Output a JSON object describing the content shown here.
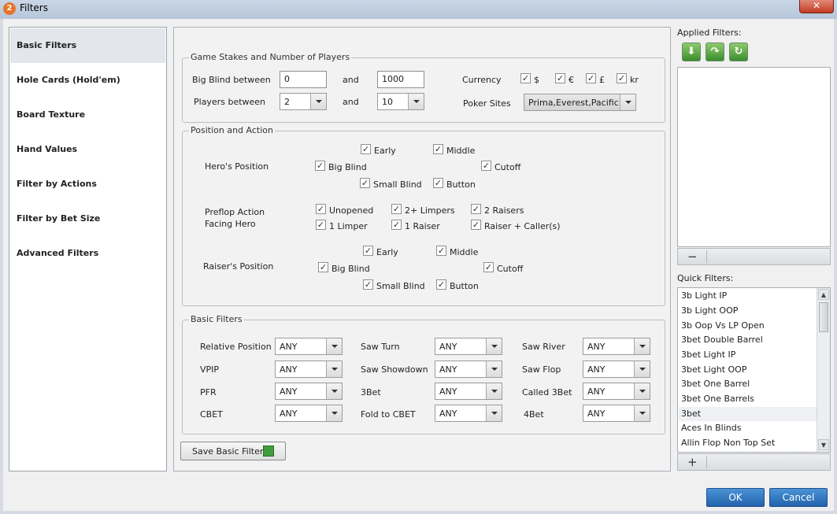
{
  "window": {
    "title": "Filters",
    "app_icon": "2",
    "close_glyph": "✕"
  },
  "nav": {
    "items": [
      "Basic Filters",
      "Hole Cards (Hold'em)",
      "Board Texture",
      "Hand Values",
      "Filter by Actions",
      "Filter by Bet Size",
      "Advanced Filters"
    ],
    "active_index": 0
  },
  "stakes": {
    "title": "Game Stakes and Number of Players",
    "big_blind_label": "Big Blind between",
    "big_blind_min": "0",
    "and1": "and",
    "big_blind_max": "1000",
    "players_label": "Players between",
    "players_min": "2",
    "and2": "and",
    "players_max": "10",
    "currency_label": "Currency",
    "currencies": [
      "$",
      "€",
      "£",
      "kr"
    ],
    "sites_label": "Poker Sites",
    "sites_value": "Prima,Everest,Pacific"
  },
  "position": {
    "title": "Position and Action",
    "hero_label": "Hero's Position",
    "hero": {
      "early": "Early",
      "middle": "Middle",
      "big_blind": "Big Blind",
      "cutoff": "Cutoff",
      "small_blind": "Small Blind",
      "button": "Button"
    },
    "preflop_label_1": "Preflop Action",
    "preflop_label_2": "Facing Hero",
    "preflop": {
      "unopened": "Unopened",
      "limpers2": "2+ Limpers",
      "raisers2": "2 Raisers",
      "limper1": "1 Limper",
      "raiser1": "1 Raiser",
      "raiser_caller": "Raiser + Caller(s)"
    },
    "raiser_label": "Raiser's Position",
    "raiser": {
      "early": "Early",
      "middle": "Middle",
      "big_blind": "Big Blind",
      "cutoff": "Cutoff",
      "small_blind": "Small Blind",
      "button": "Button"
    }
  },
  "basic": {
    "title": "Basic Filters",
    "fields": [
      {
        "label": "Relative Position",
        "value": "ANY"
      },
      {
        "label": "Saw Turn",
        "value": "ANY"
      },
      {
        "label": "Saw River",
        "value": "ANY"
      },
      {
        "label": "VPIP",
        "value": "ANY"
      },
      {
        "label": "Saw Showdown",
        "value": "ANY"
      },
      {
        "label": "Saw Flop",
        "value": "ANY"
      },
      {
        "label": "PFR",
        "value": "ANY"
      },
      {
        "label": "3Bet",
        "value": "ANY"
      },
      {
        "label": "Called 3Bet",
        "value": "ANY"
      },
      {
        "label": "CBET",
        "value": "ANY"
      },
      {
        "label": "Fold to CBET",
        "value": "ANY"
      },
      {
        "label": "4Bet",
        "value": "ANY"
      }
    ]
  },
  "save_basic_label": "Save Basic Filters",
  "applied": {
    "label": "Applied Filters:",
    "remove_glyph": "−"
  },
  "quick": {
    "label": "Quick Filters:",
    "add_glyph": "+",
    "items": [
      "3b Light IP",
      "3b Light OOP",
      "3b Oop Vs LP Open",
      "3bet Double Barrel",
      "3bet Light IP",
      "3bet Light OOP",
      "3bet One Barrel",
      "3bet One Barrels",
      "3bet",
      "Aces In Blinds",
      "Allin Flop Non Top Set"
    ],
    "selected_index": 8
  },
  "buttons": {
    "ok": "OK",
    "cancel": "Cancel"
  }
}
